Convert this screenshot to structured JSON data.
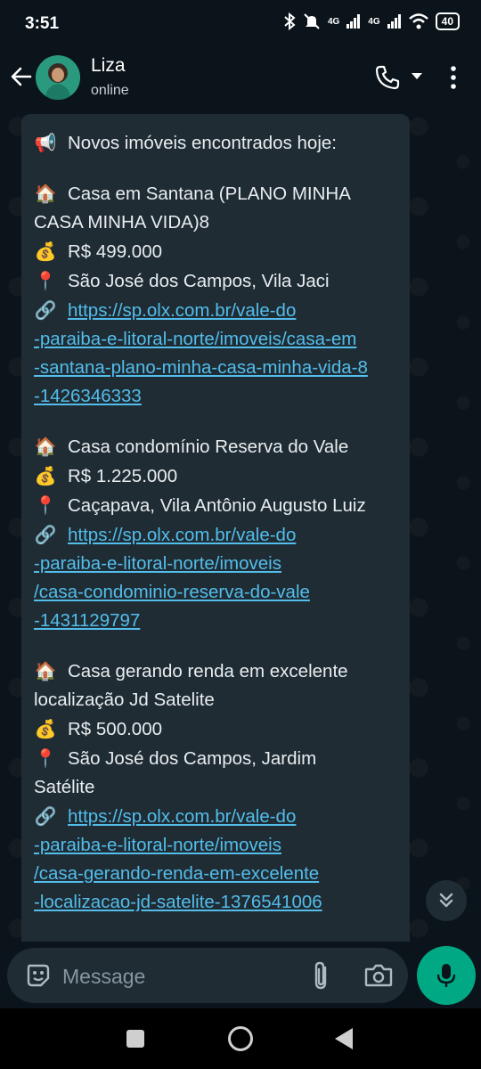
{
  "status_bar": {
    "time": "3:51",
    "network": "4G",
    "network2": "4G",
    "battery": "40"
  },
  "header": {
    "contact_name": "Liza",
    "contact_status": "online"
  },
  "message": {
    "intro_emoji": "📢",
    "intro": "Novos imóveis encontrados hoje:",
    "listings": [
      {
        "home_emoji": "🏠",
        "title_line1": "Casa em Santana (PLANO MINHA",
        "title_line2": "CASA MINHA VIDA)8",
        "price_emoji": "💰",
        "price": "R$ 499.000",
        "location_emoji": "📍",
        "location_line1": "São José dos Campos, Vila Jaci",
        "location_line2": "",
        "link_emoji": "🔗",
        "link_line1": "https://sp.olx.com.br/vale-do",
        "link_line2": "-paraiba-e-litoral-norte/imoveis/casa-em",
        "link_line3": "-santana-plano-minha-casa-minha-vida-8",
        "link_line4": "-1426346333"
      },
      {
        "home_emoji": "🏠",
        "title_line1": "Casa condomínio Reserva do Vale",
        "title_line2": "",
        "price_emoji": "💰",
        "price": "R$ 1.225.000",
        "location_emoji": "📍",
        "location_line1": "Caçapava, Vila Antônio Augusto Luiz",
        "location_line2": "",
        "link_emoji": "🔗",
        "link_line1": "https://sp.olx.com.br/vale-do",
        "link_line2": "-paraiba-e-litoral-norte/imoveis",
        "link_line3": "/casa-condominio-reserva-do-vale",
        "link_line4": "-1431129797"
      },
      {
        "home_emoji": "🏠",
        "title_line1": "Casa gerando renda em excelente",
        "title_line2": "localização Jd Satelite",
        "price_emoji": "💰",
        "price": "R$ 500.000",
        "location_emoji": "📍",
        "location_line1": "São José dos Campos, Jardim",
        "location_line2": "Satélite",
        "link_emoji": "🔗",
        "link_line1": "https://sp.olx.com.br/vale-do",
        "link_line2": "-paraiba-e-litoral-norte/imoveis",
        "link_line3": "/casa-gerando-renda-em-excelente",
        "link_line4": "-localizacao-jd-satelite-1376541006"
      }
    ]
  },
  "input": {
    "placeholder": "Message"
  },
  "icons": {
    "back": "arrow-left-icon",
    "call": "phone-icon",
    "more": "more-vertical-icon",
    "emoji": "emoji-icon",
    "attach": "paperclip-icon",
    "camera": "camera-icon",
    "mic": "mic-icon",
    "scroll": "double-chevron-down-icon"
  },
  "colors": {
    "background": "#0b141a",
    "bubble": "#1f2c34",
    "link": "#53bdeb",
    "accent": "#00a884"
  }
}
